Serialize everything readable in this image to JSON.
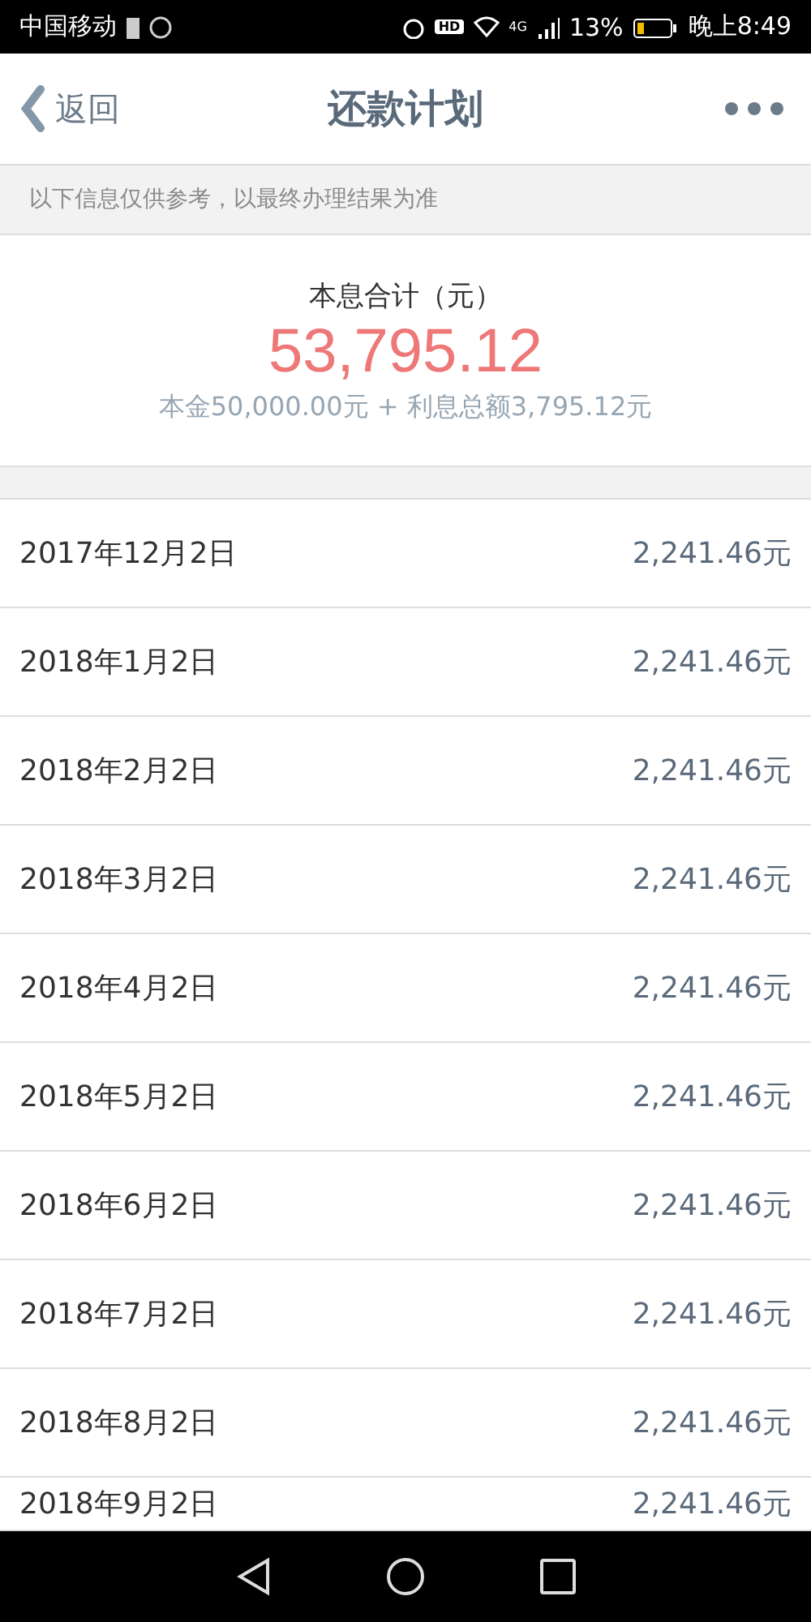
{
  "status_bar": {
    "carrier": "中国移动",
    "battery_percent": "13%",
    "time": "晚上8:49",
    "signal_label": "4G",
    "hd_label": "HD"
  },
  "header": {
    "back_label": "返回",
    "title": "还款计划"
  },
  "notice": "以下信息仅供参考，以最终办理结果为准",
  "summary": {
    "label": "本息合计（元）",
    "total": "53,795.12",
    "breakdown": "本金50,000.00元 + 利息总额3,795.12元"
  },
  "schedule": [
    {
      "date": "2017年12月2日",
      "amount": "2,241.46元"
    },
    {
      "date": "2018年1月2日",
      "amount": "2,241.46元"
    },
    {
      "date": "2018年2月2日",
      "amount": "2,241.46元"
    },
    {
      "date": "2018年3月2日",
      "amount": "2,241.46元"
    },
    {
      "date": "2018年4月2日",
      "amount": "2,241.46元"
    },
    {
      "date": "2018年5月2日",
      "amount": "2,241.46元"
    },
    {
      "date": "2018年6月2日",
      "amount": "2,241.46元"
    },
    {
      "date": "2018年7月2日",
      "amount": "2,241.46元"
    },
    {
      "date": "2018年8月2日",
      "amount": "2,241.46元"
    },
    {
      "date": "2018年9月2日",
      "amount": "2,241.46元"
    }
  ]
}
